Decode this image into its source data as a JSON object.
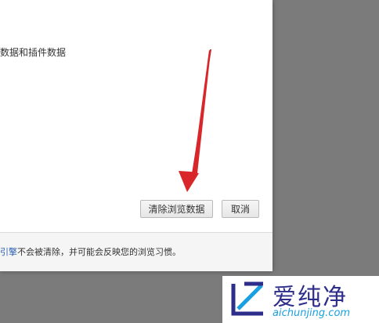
{
  "dialog": {
    "partial_option_text": "数据和插件数据",
    "buttons": {
      "clear_label": "清除浏览数据",
      "cancel_label": "取消"
    },
    "footer": {
      "link_text": "引擎",
      "rest_text": "不会被清除，并可能会反映您的浏览习惯。"
    }
  },
  "watermark": {
    "name_cn": "爱纯净",
    "url": "aichunjing.com"
  },
  "colors": {
    "background": "#7b7b7b",
    "arrow": "#d8262a",
    "link": "#2a5db0",
    "logo_blue": "#2d2d8a",
    "logo_url": "#1aa0e0"
  }
}
